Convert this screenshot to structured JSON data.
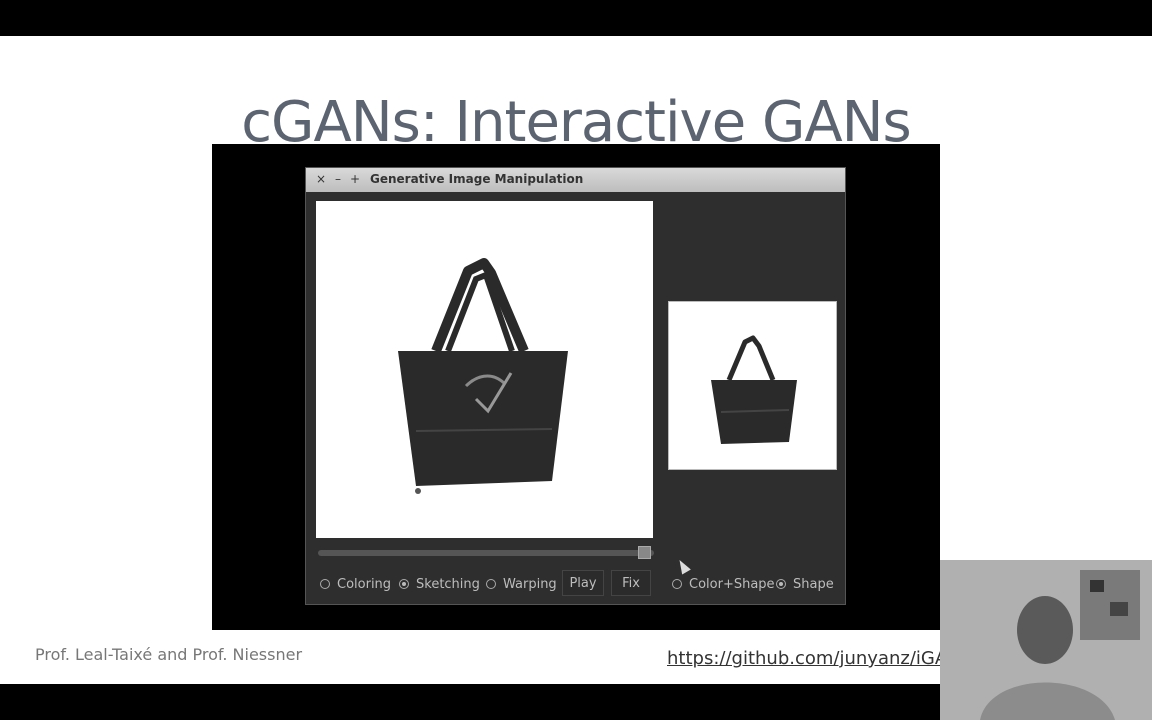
{
  "slide": {
    "title": "cGANs: Interactive GANs",
    "footer_author": "Prof. Leal-Taixé and Prof. Niessner",
    "footer_link": "https://github.com/junyanz/iGAN"
  },
  "window": {
    "title": "Generative Image Manipulation",
    "controls": [
      "×",
      "–",
      "+"
    ],
    "modes": [
      {
        "label": "Coloring",
        "selected": false
      },
      {
        "label": "Sketching",
        "selected": true
      },
      {
        "label": "Warping",
        "selected": false
      }
    ],
    "play_label": "Play",
    "fix_label": "Fix",
    "constraints": [
      {
        "label": "Color+Shape",
        "selected": false
      },
      {
        "label": "Shape",
        "selected": true
      }
    ]
  },
  "colors": {
    "window_bg": "#2e2e2e",
    "title_text": "#5b6470",
    "bag": "#2a2a2a"
  }
}
